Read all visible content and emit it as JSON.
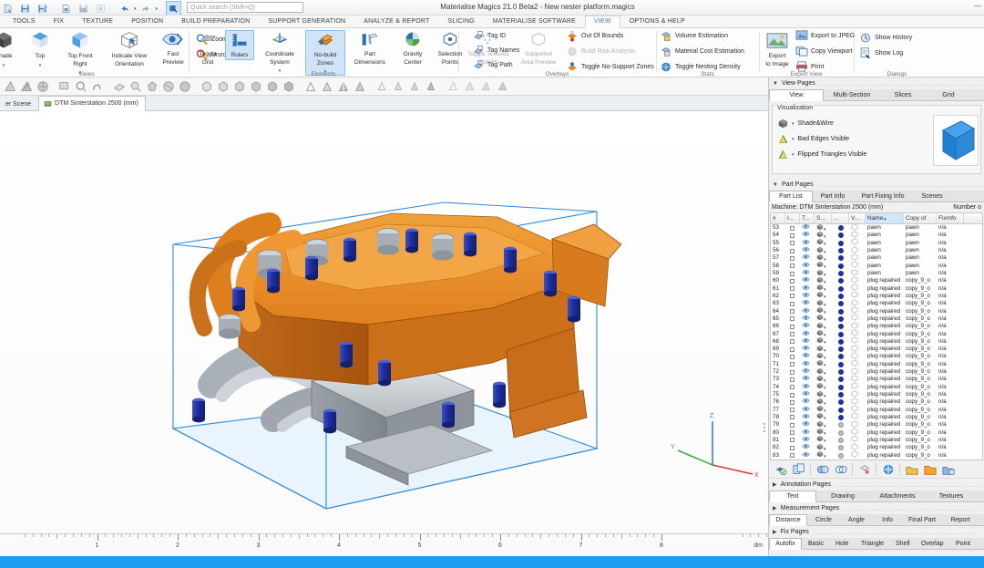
{
  "window": {
    "title": "Materialise Magics 21.0 Beta2 - New nester platform.magics",
    "minimize_label": "—"
  },
  "quick_access": {
    "search_placeholder": "Quick search (Shift+Q)",
    "search_value": "",
    "items": [
      {
        "name": "new-project-icon"
      },
      {
        "name": "save-icon"
      },
      {
        "name": "save-as-icon"
      },
      {
        "name": "import-part-icon"
      },
      {
        "name": "save-part-icon"
      },
      {
        "name": "save-selected-icon"
      },
      {
        "name": "undo-icon"
      },
      {
        "name": "redo-icon"
      },
      {
        "name": "select-rectangle-icon"
      },
      {
        "name": "select-surface-icon"
      },
      {
        "name": "select-plane-icon"
      },
      {
        "name": "zoom-in-icon"
      },
      {
        "name": "zoom-out-icon"
      },
      {
        "name": "magic-wand-icon"
      }
    ]
  },
  "ribbon_tabs": [
    {
      "label": "TOOLS",
      "active": false
    },
    {
      "label": "FIX",
      "active": false
    },
    {
      "label": "TEXTURE",
      "active": false
    },
    {
      "label": "POSITION",
      "active": false
    },
    {
      "label": "BUILD PREPARATION",
      "active": false
    },
    {
      "label": "SUPPORT GENERATION",
      "active": false
    },
    {
      "label": "ANALYZE & REPORT",
      "active": false
    },
    {
      "label": "SLICING",
      "active": false
    },
    {
      "label": "MATERIALISE SOFTWARE",
      "active": false
    },
    {
      "label": "VIEW",
      "active": true
    },
    {
      "label": "OPTIONS & HELP",
      "active": false
    }
  ],
  "ribbon": {
    "groups": {
      "views": {
        "label": "Views",
        "shade": "Shade",
        "top": "Top",
        "top_front_right": "Top Front\nRight",
        "top_front_right_l1": "Top Front",
        "top_front_right_l2": "Right",
        "indicate_l1": "Indicate View",
        "indicate_l2": "Orientation",
        "fast_l1": "Fast",
        "fast_l2": "Preview",
        "zoom": "Zoom",
        "unzoom": "Unzoom"
      },
      "elements": {
        "label": "Elements",
        "toggle_grid_l1": "Toggle",
        "toggle_grid_l2": "Grid",
        "rulers": "Rulers",
        "coord_l1": "Coordinate",
        "coord_l2": "System",
        "nobuild_l1": "No-build",
        "nobuild_l2": "Zones",
        "partdim_l1": "Part",
        "partdim_l2": "Dimensions",
        "gravity_l1": "Gravity",
        "gravity_l2": "Center",
        "selpoints_l1": "Selection",
        "selpoints_l2": "Points",
        "tag_id": "Tag ID",
        "tag_names": "Tag Names",
        "tag_path": "Tag Path"
      },
      "overlays": {
        "label": "Overlays",
        "textures_l1": "Toggle Textures",
        "textures_l2": "Visibility",
        "supported_l1": "Supported",
        "supported_l2": "Area Preview",
        "out_of_bounds": "Out Of Bounds",
        "build_risk": "Build Risk Analysis",
        "no_support": "Toggle No-Support Zones"
      },
      "stats": {
        "label": "Stats",
        "volume": "Volume Estimation",
        "material_cost": "Material Cost Estimation",
        "nesting_density": "Toggle Nesting Density"
      },
      "export_view": {
        "label": "Export View",
        "export_image_l1": "Export",
        "export_image_l2": "to Image",
        "export_jpeg": "Export to JPEG",
        "copy_viewport": "Copy Viewport",
        "print": "Print"
      },
      "dialogs": {
        "label": "Dialogs",
        "show_history": "Show History",
        "show_log": "Show Log"
      }
    }
  },
  "scene_tabs": [
    {
      "label": "er Scene",
      "active": false
    },
    {
      "label": "DTM Sinterstation 2500 (mm)",
      "active": true
    }
  ],
  "viewport": {
    "axes": {
      "x": "X",
      "y": "Y",
      "z": "Z"
    },
    "colors": {
      "axis_x": "#d63a3a",
      "axis_y": "#3faa3f",
      "axis_z": "#3a6fd6",
      "platform": "#2e8ad6",
      "part_orange": "#de7a1c",
      "part_gray": "#b5babf",
      "part_blue": "#1f2f9e"
    }
  },
  "ruler": {
    "unit": "dm",
    "labels": [
      "1",
      "2",
      "3",
      "4",
      "5",
      "6",
      "7",
      "8"
    ]
  },
  "right_panel": {
    "view_pages": {
      "title": "View Pages",
      "expanded": true,
      "tabs": [
        {
          "label": "View",
          "active": true
        },
        {
          "label": "Multi-Section",
          "active": false
        },
        {
          "label": "Slices",
          "active": false
        },
        {
          "label": "Grid",
          "active": false
        }
      ],
      "group_title": "Visualization",
      "rows": [
        {
          "label": "Shade&Wire",
          "icon": "shade-wire-icon"
        },
        {
          "label": "Bad Edges Visible",
          "icon": "bad-edges-icon"
        },
        {
          "label": "Flipped Triangles Visible",
          "icon": "flipped-triangles-icon"
        }
      ]
    },
    "part_pages": {
      "title": "Part Pages",
      "expanded": true,
      "tabs": [
        {
          "label": "Part List",
          "active": true
        },
        {
          "label": "Part Info",
          "active": false
        },
        {
          "label": "Part Fixing Info",
          "active": false
        },
        {
          "label": "Scenes",
          "active": false
        }
      ],
      "machine_label": "Machine: DTM Sinterstation 2500 (mm)",
      "count_label": "Number o",
      "columns": [
        "#",
        "I...",
        "T...",
        "S...",
        "...",
        "V...",
        "Name",
        "Copy of",
        "FixInfo"
      ],
      "sort_column": "Name",
      "sort_arrow": "▲",
      "rows": [
        {
          "num": "53",
          "name": "pawn",
          "copy_of": "pawn",
          "fixinfo": "n/a",
          "dot": "blue"
        },
        {
          "num": "54",
          "name": "pawn",
          "copy_of": "pawn",
          "fixinfo": "n/a",
          "dot": "blue"
        },
        {
          "num": "55",
          "name": "pawn",
          "copy_of": "pawn",
          "fixinfo": "n/a",
          "dot": "blue"
        },
        {
          "num": "56",
          "name": "pawn",
          "copy_of": "pawn",
          "fixinfo": "n/a",
          "dot": "blue"
        },
        {
          "num": "57",
          "name": "pawn",
          "copy_of": "pawn",
          "fixinfo": "n/a",
          "dot": "blue"
        },
        {
          "num": "58",
          "name": "pawn",
          "copy_of": "pawn",
          "fixinfo": "n/a",
          "dot": "blue"
        },
        {
          "num": "59",
          "name": "pawn",
          "copy_of": "pawn",
          "fixinfo": "n/a",
          "dot": "blue"
        },
        {
          "num": "60",
          "name": "plug repaired",
          "copy_of": "copy_9_o",
          "fixinfo": "n/a",
          "dot": "blue"
        },
        {
          "num": "61",
          "name": "plug repaired",
          "copy_of": "copy_9_o",
          "fixinfo": "n/a",
          "dot": "blue"
        },
        {
          "num": "62",
          "name": "plug repaired",
          "copy_of": "copy_9_o",
          "fixinfo": "n/a",
          "dot": "blue"
        },
        {
          "num": "63",
          "name": "plug repaired",
          "copy_of": "copy_9_o",
          "fixinfo": "n/a",
          "dot": "blue"
        },
        {
          "num": "64",
          "name": "plug repaired",
          "copy_of": "copy_9_o",
          "fixinfo": "n/a",
          "dot": "blue"
        },
        {
          "num": "65",
          "name": "plug repaired",
          "copy_of": "copy_9_o",
          "fixinfo": "n/a",
          "dot": "blue"
        },
        {
          "num": "66",
          "name": "plug repaired",
          "copy_of": "copy_9_o",
          "fixinfo": "n/a",
          "dot": "blue"
        },
        {
          "num": "67",
          "name": "plug repaired",
          "copy_of": "copy_9_o",
          "fixinfo": "n/a",
          "dot": "blue"
        },
        {
          "num": "68",
          "name": "plug repaired",
          "copy_of": "copy_9_o",
          "fixinfo": "n/a",
          "dot": "blue"
        },
        {
          "num": "69",
          "name": "plug repaired",
          "copy_of": "copy_9_o",
          "fixinfo": "n/a",
          "dot": "blue"
        },
        {
          "num": "70",
          "name": "plug repaired",
          "copy_of": "copy_9_o",
          "fixinfo": "n/a",
          "dot": "blue"
        },
        {
          "num": "71",
          "name": "plug repaired",
          "copy_of": "copy_9_o",
          "fixinfo": "n/a",
          "dot": "blue"
        },
        {
          "num": "72",
          "name": "plug repaired",
          "copy_of": "copy_9_o",
          "fixinfo": "n/a",
          "dot": "blue"
        },
        {
          "num": "73",
          "name": "plug repaired",
          "copy_of": "copy_9_o",
          "fixinfo": "n/a",
          "dot": "blue"
        },
        {
          "num": "74",
          "name": "plug repaired",
          "copy_of": "copy_9_o",
          "fixinfo": "n/a",
          "dot": "blue"
        },
        {
          "num": "75",
          "name": "plug repaired",
          "copy_of": "copy_9_o",
          "fixinfo": "n/a",
          "dot": "blue"
        },
        {
          "num": "76",
          "name": "plug repaired",
          "copy_of": "copy_9_o",
          "fixinfo": "n/a",
          "dot": "blue"
        },
        {
          "num": "77",
          "name": "plug repaired",
          "copy_of": "copy_9_o",
          "fixinfo": "n/a",
          "dot": "blue"
        },
        {
          "num": "78",
          "name": "plug repaired",
          "copy_of": "copy_9_o",
          "fixinfo": "n/a",
          "dot": "blue"
        },
        {
          "num": "79",
          "name": "plug repaired",
          "copy_of": "copy_9_o",
          "fixinfo": "n/a",
          "dot": "gray"
        },
        {
          "num": "80",
          "name": "plug repaired",
          "copy_of": "copy_9_o",
          "fixinfo": "n/a",
          "dot": "gray"
        },
        {
          "num": "81",
          "name": "plug repaired",
          "copy_of": "copy_9_o",
          "fixinfo": "n/a",
          "dot": "gray"
        },
        {
          "num": "82",
          "name": "plug repaired",
          "copy_of": "copy_9_o",
          "fixinfo": "n/a",
          "dot": "gray"
        },
        {
          "num": "83",
          "name": "plug repaired",
          "copy_of": "copy_9_o",
          "fixinfo": "n/a",
          "dot": "gray"
        }
      ]
    },
    "part_tools": [
      {
        "name": "select-all-parts-icon"
      },
      {
        "name": "duplicate-part-icon"
      },
      {
        "name": "merge-parts-icon"
      },
      {
        "name": "split-parts-icon"
      },
      {
        "name": "delete-part-icon"
      },
      {
        "name": "part-properties-icon"
      },
      {
        "name": "load-part-icon"
      },
      {
        "name": "save-part-icon"
      },
      {
        "name": "export-part-icon"
      }
    ],
    "annotation_pages": {
      "title": "Annotation Pages",
      "expanded": false,
      "tabs": [
        {
          "label": "Text",
          "active": true
        },
        {
          "label": "Drawing",
          "active": false
        },
        {
          "label": "Attachments",
          "active": false
        },
        {
          "label": "Textures",
          "active": false
        }
      ]
    },
    "measurement_pages": {
      "title": "Measurement Pages",
      "expanded": false,
      "tabs": [
        {
          "label": "Distance",
          "active": true
        },
        {
          "label": "Circle",
          "active": false
        },
        {
          "label": "Angle",
          "active": false
        },
        {
          "label": "Info",
          "active": false
        },
        {
          "label": "Final Part",
          "active": false
        },
        {
          "label": "Report",
          "active": false
        }
      ]
    },
    "fix_pages": {
      "title": "Fix Pages",
      "expanded": false,
      "tabs": [
        {
          "label": "Autofix",
          "active": true
        },
        {
          "label": "Basic",
          "active": false
        },
        {
          "label": "Hole",
          "active": false
        },
        {
          "label": "Triangle",
          "active": false
        },
        {
          "label": "Shell",
          "active": false
        },
        {
          "label": "Overlap",
          "active": false
        },
        {
          "label": "Point",
          "active": false
        }
      ]
    }
  }
}
